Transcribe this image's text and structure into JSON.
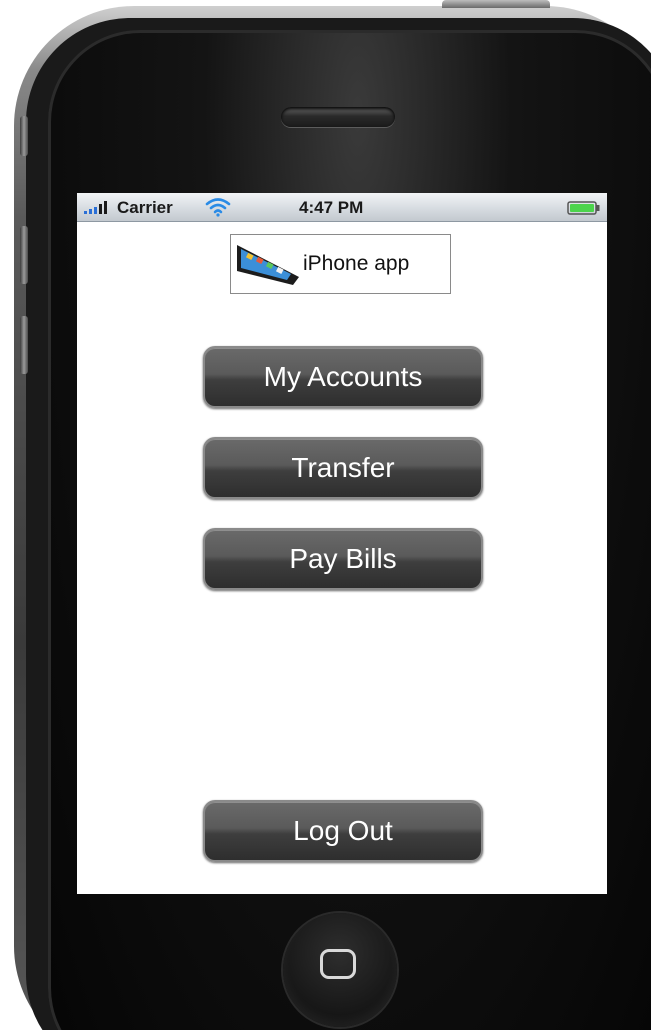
{
  "status_bar": {
    "carrier": "Carrier",
    "time": "4:47 PM",
    "signal_icon": "signal-bars-icon",
    "wifi_icon": "wifi-icon",
    "battery_icon": "battery-icon"
  },
  "logo": {
    "text": "iPhone app",
    "icon": "iphone-logo-icon"
  },
  "menu": {
    "my_accounts": "My Accounts",
    "transfer": "Transfer",
    "pay_bills": "Pay Bills",
    "log_out": "Log Out"
  },
  "hardware": {
    "home_button_icon": "home-button-icon",
    "speaker_icon": "speaker-grille"
  },
  "colors": {
    "button_dark": "#3e3e3e",
    "button_text": "#ffffff",
    "status_bar_bg": "#d9dee3",
    "wifi_blue": "#2a8be6",
    "battery_green": "#4cd44c"
  }
}
